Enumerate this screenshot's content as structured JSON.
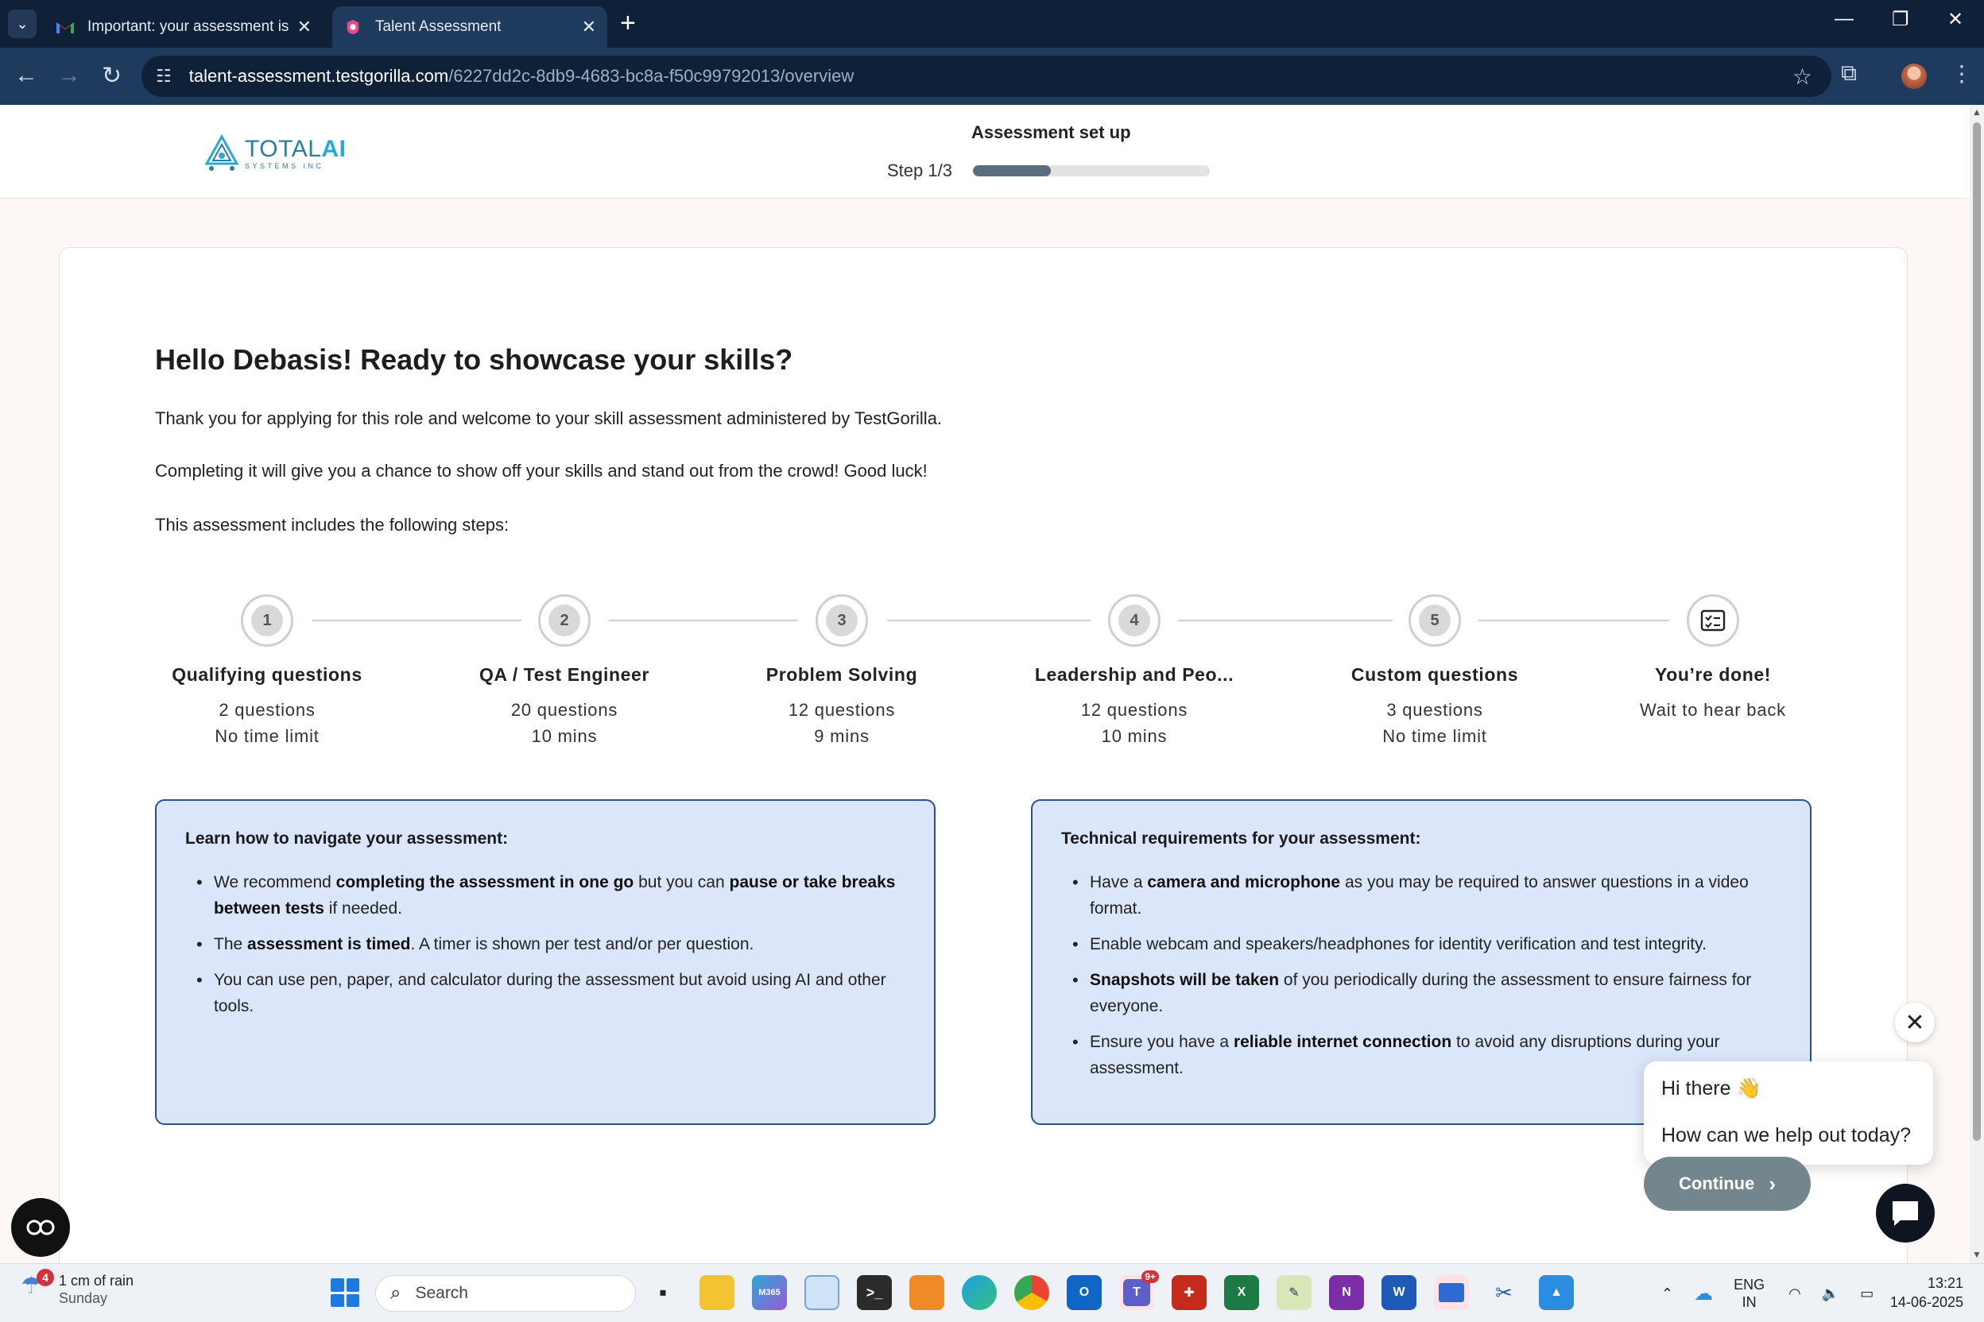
{
  "browser": {
    "tabs": [
      {
        "title": "Important: your assessment is w",
        "active": false,
        "favicon": "gmail-icon"
      },
      {
        "title": "Talent Assessment",
        "active": true,
        "favicon": "testgorilla-icon"
      }
    ],
    "url_host": "talent-assessment.testgorilla.com",
    "url_path": "/6227dd2c-8db9-4683-bc8a-f50c99792013/overview"
  },
  "header": {
    "logo_main": "TOTAL",
    "logo_accent": "AI",
    "logo_sub": "SYSTEMS INC",
    "setup_title": "Assessment set up",
    "step_label": "Step 1/3",
    "progress_fraction": 0.33
  },
  "main": {
    "greeting": "Hello Debasis! Ready to showcase your skills?",
    "intro1": "Thank you for applying for this role and welcome to your skill assessment administered by TestGorilla.",
    "intro2": "Completing it will give you a chance to show off your skills and stand out from the crowd! Good luck!",
    "intro3": "This assessment includes the following steps:",
    "steps": [
      {
        "num": "1",
        "name": "Qualifying questions",
        "line1": "2 questions",
        "line2": "No time limit"
      },
      {
        "num": "2",
        "name": "QA / Test Engineer",
        "line1": "20 questions",
        "line2": "10 mins"
      },
      {
        "num": "3",
        "name": "Problem Solving",
        "line1": "12 questions",
        "line2": "9 mins"
      },
      {
        "num": "4",
        "name": "Leadership and Peo...",
        "line1": "12 questions",
        "line2": "10 mins"
      },
      {
        "num": "5",
        "name": "Custom questions",
        "line1": "3 questions",
        "line2": "No time limit"
      },
      {
        "num": "",
        "name": "You’re done!",
        "line1": "Wait to hear back",
        "line2": ""
      }
    ],
    "navigate_box": {
      "title": "Learn how to navigate your assessment:",
      "b1_pre": "We recommend ",
      "b1_bold1": "completing the assessment in one go",
      "b1_mid": " but you can ",
      "b1_bold2": "pause or take breaks between tests",
      "b1_post": " if needed.",
      "b2_pre": "The ",
      "b2_bold": "assessment is timed",
      "b2_post": ". A timer is shown per test and/or per question.",
      "b3": "You can use pen, paper, and calculator during the assessment but avoid using AI and other tools."
    },
    "tech_box": {
      "title": "Technical requirements for your assessment:",
      "b1_pre": "Have a ",
      "b1_bold": "camera and microphone",
      "b1_post": " as you may be required to answer questions in a video format.",
      "b2": "Enable webcam and speakers/headphones for identity verification and test integrity.",
      "b3_bold": "Snapshots will be taken",
      "b3_post": " of you periodically during the assessment to ensure fairness for everyone.",
      "b4_pre": "Ensure you have a ",
      "b4_bold": "reliable internet connection",
      "b4_post": " to avoid any disruptions during your assessment."
    },
    "continue_label": "Continue"
  },
  "chat": {
    "greeting": "Hi there 👋",
    "question": "How can we help out today?"
  },
  "taskbar": {
    "weather_line1": "1 cm of rain",
    "weather_line2": "Sunday",
    "weather_badge": "4",
    "search_placeholder": "Search",
    "lang_line1": "ENG",
    "lang_line2": "IN",
    "time": "13:21",
    "date": "14-06-2025",
    "teams_badge": "9+"
  },
  "colors": {
    "chrome_dark": "#0f2138",
    "chrome_toolbar": "#1e3a5c",
    "info_bg": "#dbe6fa",
    "info_border": "#2d4e92",
    "continue_bg": "#73858d",
    "logo": "#2aa9d6"
  }
}
